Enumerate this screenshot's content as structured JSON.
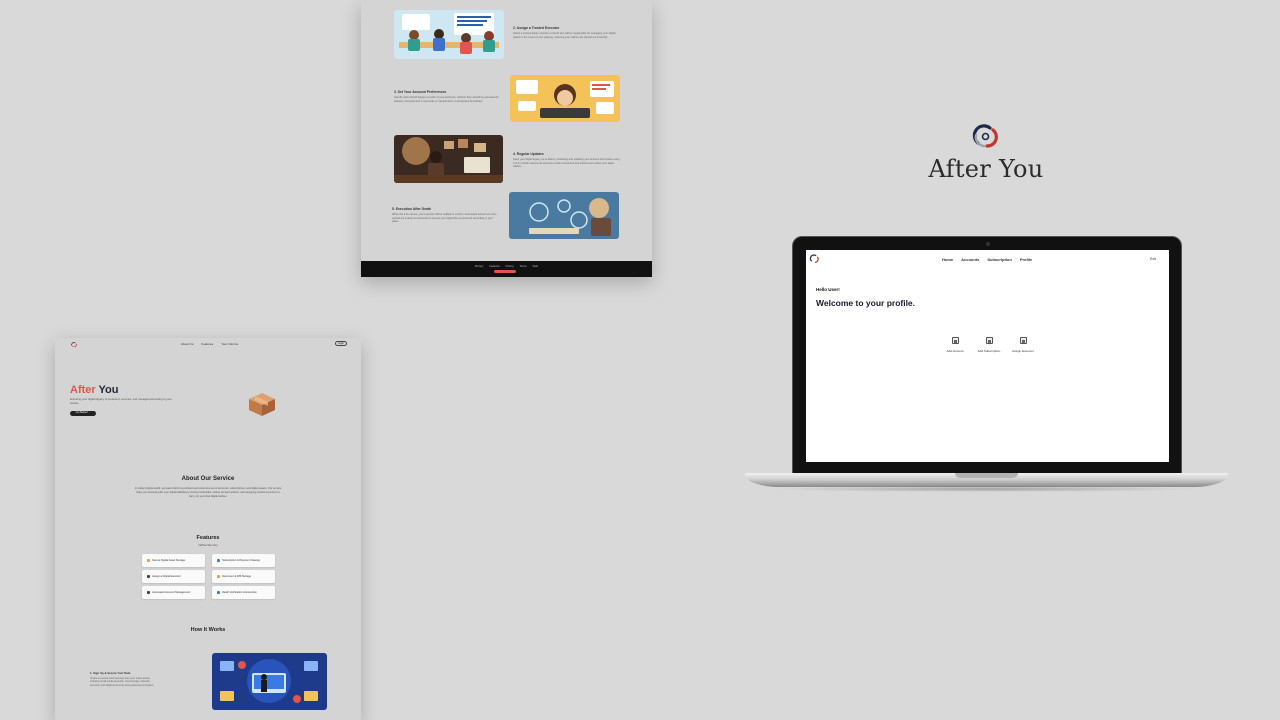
{
  "top_page": {
    "steps": [
      {
        "title": "2. Assign a Trusted Executor",
        "desc": "Select a trusted family member or friend who will be responsible for managing your digital assets in the event of your passing, ensuring your wishes are carried out smoothly."
      },
      {
        "title": "3. Set Your Account Preferences",
        "desc": "Specify what should happen to each of your accounts, whether they should be permanently deleted, converted into a memorial, or transferred to a designated beneficiary."
      },
      {
        "title": "4. Regular Updates",
        "desc": "Keep your digital legacy up to date by reviewing and updating your account information every 3 to 6 months. Ensure all accounts remain connected and preferences reflect your latest wishes."
      },
      {
        "title": "5. Execution After Death",
        "desc": "When the time comes, your executor will be notified to confirm. Automated actions are then carried out exactly as instructed to ensure your digital life is preserved according to your plans."
      }
    ],
    "footer_links": [
      "Privacy",
      "Features",
      "Pricing",
      "Terms",
      "Start"
    ]
  },
  "left_page": {
    "nav_links": [
      "About Us",
      "Features",
      "Your Informs"
    ],
    "login": "Login",
    "hero": {
      "title_accent": "After",
      "title_rest": "You",
      "desc": "Ensuring your digital legacy is protected, secured, and managed according to your wishes.",
      "button": "Get Started →"
    },
    "about": {
      "title": "About Our Service",
      "desc": "In today's digital world, we leave behind a profound and extensive set of accounts, subscriptions, and digital assets. Our service helps you securely plan your digital afterlife by storing credentials, setting account actions, and assigning trusted executors to carry out your final digital wishes."
    },
    "features": {
      "title": "Features",
      "subtitle": "(What We Do)",
      "items": [
        {
          "label": "Secure Digital Asset Storage",
          "color": "#e3a23a"
        },
        {
          "label": "Subscription & Payment Cleanup",
          "color": "#3a7be3"
        },
        {
          "label": "Assign a Digital Executor",
          "color": "#444444"
        },
        {
          "label": "Document & Will Storage",
          "color": "#e3a23a"
        },
        {
          "label": "Automated Account Management",
          "color": "#444444"
        },
        {
          "label": "Death Verification & Execution",
          "color": "#3a7be3"
        }
      ]
    },
    "how_it_works": {
      "title": "How It Works",
      "step_title": "1. Sign Up & Secure Your Data",
      "step_desc": "Create an account and securely store your online assets, including social media accounts, cloud storage, financial accounts, and digital documents using advanced encryption."
    }
  },
  "brand": {
    "name": "After You",
    "colors": {
      "red": "#c0392b",
      "navy": "#1e2a4a",
      "silver": "#9aa3ad"
    }
  },
  "laptop": {
    "nav": [
      "Home",
      "Accounts",
      "Subscription",
      "Profile"
    ],
    "exit": "Exit",
    "hello": "Hello User!",
    "welcome": "Welcome to your profile.",
    "actions": [
      {
        "label": "Add Account",
        "icon": "add-account-icon"
      },
      {
        "label": "Add Subscription",
        "icon": "add-subscription-icon"
      },
      {
        "label": "Assign Executor",
        "icon": "assign-executor-icon"
      }
    ]
  }
}
